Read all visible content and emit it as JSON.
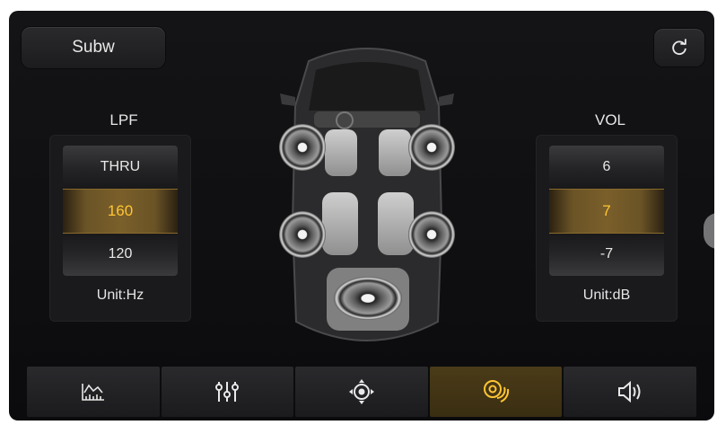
{
  "top": {
    "mode_label": "Subw"
  },
  "lpf": {
    "label": "LPF",
    "values": [
      "THRU",
      "160",
      "120"
    ],
    "unit": "Unit:Hz"
  },
  "vol": {
    "label": "VOL",
    "values": [
      "6",
      "7",
      "-7"
    ],
    "unit": "Unit:dB"
  },
  "icons": {
    "reset": "refresh-icon",
    "car": "car-speakers-icon",
    "nav": [
      "spectrum-icon",
      "equalizer-icon",
      "balance-fader-icon",
      "subwoofer-icon",
      "volume-icon"
    ]
  },
  "nav": {
    "active_index": 3
  },
  "colors": {
    "accent": "#ffc533",
    "active_tab": "#3a2e12"
  }
}
